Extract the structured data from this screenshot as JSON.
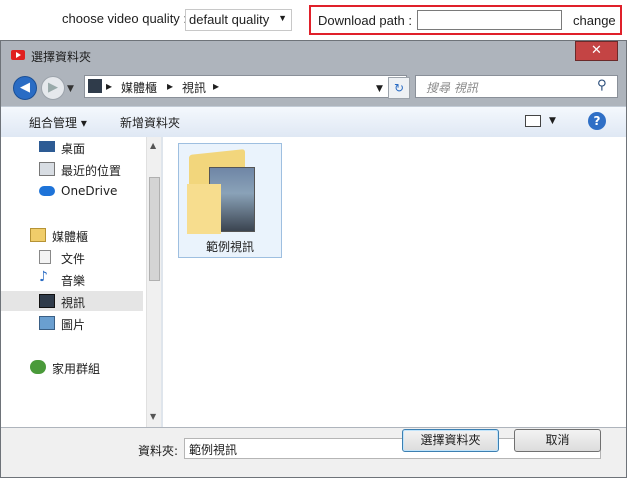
{
  "app": {
    "quality_label": "choose video quality :",
    "quality_value": "default quality",
    "download_label": "Download path :",
    "download_value": "",
    "change_label": "change"
  },
  "dialog": {
    "title": "選擇資料夾",
    "close_symbol": "✕",
    "breadcrumb": [
      "媒體櫃",
      "視訊"
    ],
    "search_placeholder": "搜尋 視訊",
    "toolbar": {
      "organize": "組合管理 ▾",
      "new_folder": "新增資料夾"
    },
    "nav": [
      {
        "label": "桌面",
        "icon": "desktop-icon"
      },
      {
        "label": "最近的位置",
        "icon": "recent-places-icon"
      },
      {
        "label": "OneDrive",
        "icon": "onedrive-icon"
      },
      {
        "label": "媒體櫃",
        "icon": "libraries-icon"
      },
      {
        "label": "文件",
        "icon": "documents-icon"
      },
      {
        "label": "音樂",
        "icon": "music-icon"
      },
      {
        "label": "視訊",
        "icon": "videos-icon",
        "selected": true
      },
      {
        "label": "圖片",
        "icon": "pictures-icon"
      },
      {
        "label": "家用群組",
        "icon": "homegroup-icon"
      }
    ],
    "files": [
      {
        "label": "範例視訊",
        "icon": "folder-icon"
      }
    ],
    "folder_field_label": "資料夾:",
    "folder_field_value": "範例視訊",
    "ok_label": "選擇資料夾",
    "cancel_label": "取消"
  }
}
